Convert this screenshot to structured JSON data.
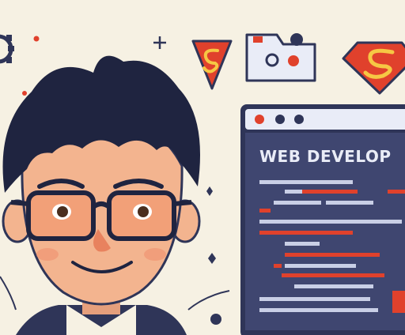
{
  "illustration": {
    "subject": "cartoon-web-developer-portrait",
    "browser": {
      "title": "WEB DEVELOP"
    },
    "colors": {
      "background": "#f6f1e3",
      "navy": "#2f3558",
      "accent_red": "#e0412c",
      "code_line_light": "#c9cfe6",
      "skin": "#f3b48f",
      "hair": "#1f2440"
    },
    "icons": [
      "gear-icon",
      "sparkle-icon",
      "superman-shield-icon",
      "folder-card-icon",
      "superman-emblem-icon"
    ]
  }
}
